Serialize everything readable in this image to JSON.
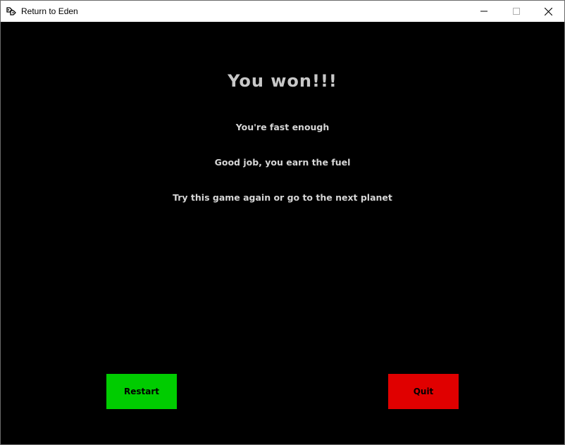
{
  "window": {
    "title": "Return to Eden",
    "controls": {
      "minimize": "minimize-icon",
      "maximize": "maximize-icon",
      "close": "close-icon"
    }
  },
  "screen": {
    "headline": "You won!!!",
    "lines": [
      "You're fast enough",
      "Good job, you earn the fuel",
      "Try this game again or go to the next planet"
    ]
  },
  "buttons": {
    "restart": {
      "label": "Restart",
      "color": "#00cc00"
    },
    "quit": {
      "label": "Quit",
      "color": "#e00000"
    }
  },
  "colors": {
    "background": "#000000",
    "text": "#c8c8c8"
  }
}
